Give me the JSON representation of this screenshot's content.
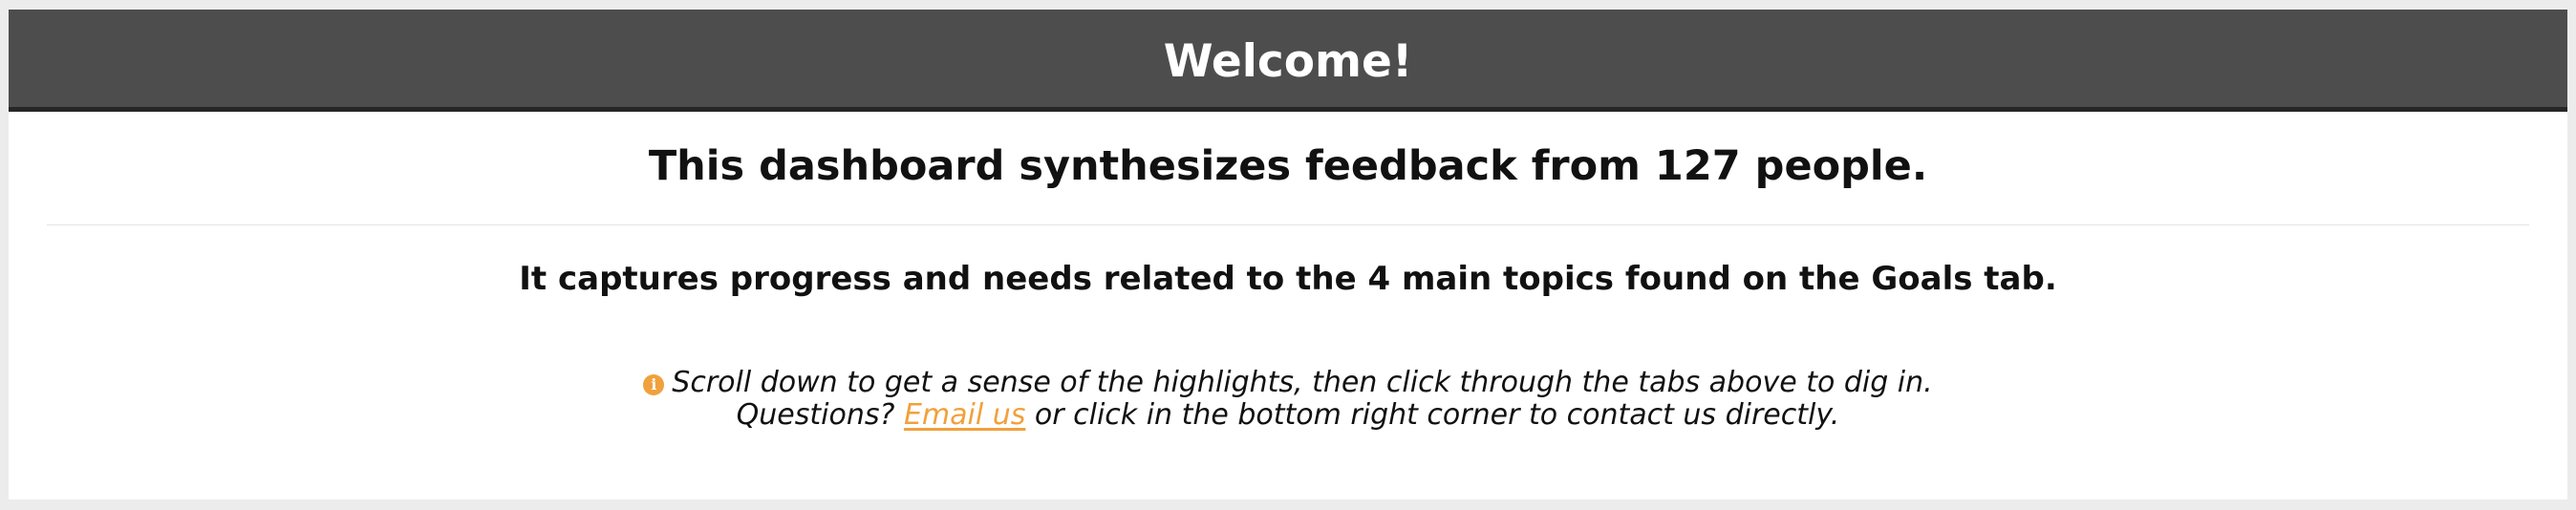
{
  "header": {
    "title": "Welcome!"
  },
  "main": {
    "headline": "This dashboard synthesizes feedback from 127 people.",
    "subheading": "It captures progress and needs related to the 4 main topics found on the Goals tab.",
    "info": {
      "icon": "info-circle-icon",
      "line1": "Scroll down to get a sense of the highlights, then click through the tabs above to dig in.",
      "line2_prefix": "Questions? ",
      "email_link_label": "Email us",
      "line2_suffix": " or click in the bottom right corner to contact us directly."
    }
  },
  "colors": {
    "header_bg": "#4d4d4d",
    "header_border": "#262626",
    "accent": "#f0a13c",
    "page_bg": "#ececec",
    "panel_bg": "#ffffff"
  }
}
